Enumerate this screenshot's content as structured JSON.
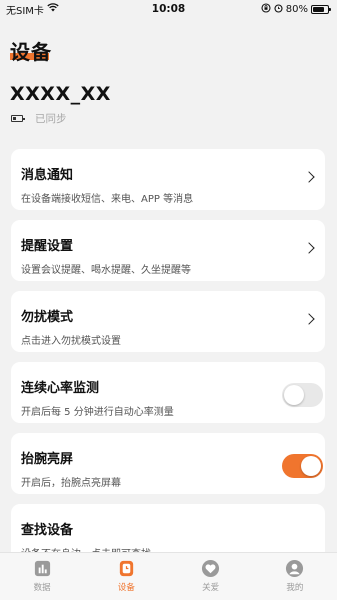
{
  "status_bar": {
    "carrier": "无SIM卡",
    "time": "10:08",
    "battery_percent": "80%"
  },
  "header": {
    "title": "设备",
    "device_name": "XXXX_XX",
    "sync_status": "已同步"
  },
  "cards": [
    {
      "title": "消息通知",
      "subtitle": "在设备端接收短信、来电、APP 等消息",
      "control": "chevron"
    },
    {
      "title": "提醒设置",
      "subtitle": "设置会议提醒、喝水提醒、久坐提醒等",
      "control": "chevron"
    },
    {
      "title": "勿扰模式",
      "subtitle": "点击进入勿扰模式设置",
      "control": "chevron"
    },
    {
      "title": "连续心率监测",
      "subtitle": "开启后每 5 分钟进行自动心率测量",
      "control": "toggle",
      "toggle_on": false
    },
    {
      "title": "抬腕亮屏",
      "subtitle": "开启后，抬腕点亮屏幕",
      "control": "toggle",
      "toggle_on": true
    },
    {
      "title": "查找设备",
      "subtitle": "设备不在身边，点击即可查找",
      "control": "none"
    }
  ],
  "tab_bar": {
    "tabs": [
      {
        "label": "数据",
        "icon": "data-icon",
        "active": false
      },
      {
        "label": "设备",
        "icon": "watch-icon",
        "active": true
      },
      {
        "label": "关爱",
        "icon": "heart-icon",
        "active": false
      },
      {
        "label": "我的",
        "icon": "profile-icon",
        "active": false
      }
    ]
  },
  "colors": {
    "accent": "#f0752e",
    "background": "#f2f2f2",
    "card": "#ffffff",
    "inactive_tab": "#9a9a9a"
  }
}
